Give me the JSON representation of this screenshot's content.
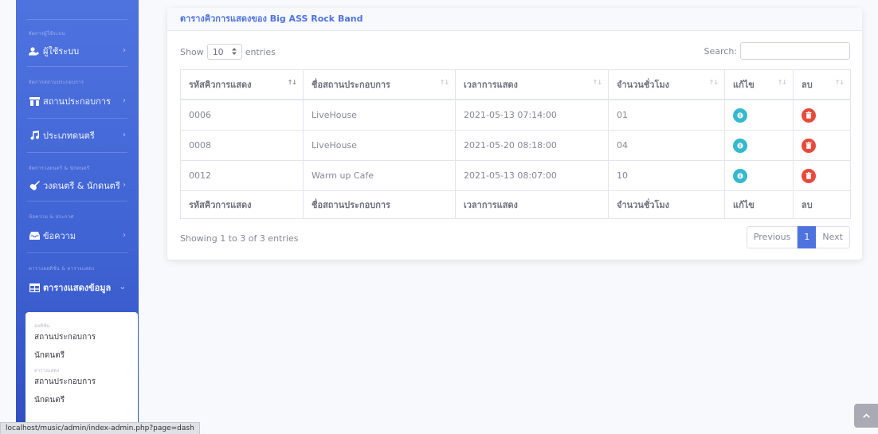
{
  "sidebar": {
    "sections": [
      {
        "heading": "จัดการผู้ใช้ระบบ",
        "items": [
          {
            "label": "ผู้ใช้ระบบ",
            "icon": "users-icon",
            "chevron": "›"
          }
        ]
      },
      {
        "heading": "จัดการสถานประกอบการ",
        "items": [
          {
            "label": "สถานประกอบการ",
            "icon": "store-icon",
            "chevron": "›"
          },
          {
            "label": "ประเภทดนตรี",
            "icon": "music-icon",
            "chevron": "›"
          }
        ]
      },
      {
        "heading": "จัดการวงดนตรี & นักดนตรี",
        "items": [
          {
            "label": "วงดนตรี & นักดนตรี",
            "icon": "guitar-icon",
            "chevron": "›"
          }
        ]
      },
      {
        "heading": "ข้อความ & ประกาศ",
        "items": [
          {
            "label": "ข้อความ",
            "icon": "inbox-icon",
            "chevron": "›"
          }
        ]
      },
      {
        "heading": "ตารางออดิชั่น & ตารางแสดง",
        "items": [
          {
            "label": "ตารางแสดงข้อมูล",
            "icon": "table-icon",
            "chevron": "⌄"
          }
        ]
      }
    ],
    "submenu": {
      "heading1": "ออดิชั่น",
      "items1": [
        "สถานประกอบการ",
        "นักดนตรี"
      ],
      "heading2": "ตารางแสดง",
      "items2": [
        "สถานประกอบการ",
        "นักดนตรี"
      ]
    }
  },
  "statusbar": {
    "url": "localhost/music/admin/index-admin.php?page=dash"
  },
  "card": {
    "title": "ตารางคิวการแสดงของ Big ASS Rock Band",
    "show_label": "Show",
    "entries_value": "10",
    "entries_label": "entries",
    "search_label": "Search:",
    "search_value": "",
    "columns": [
      "รหัสคิวการแสดง",
      "ชื่อสถานประกอบการ",
      "เวลาการแสดง",
      "จำนวนชั่วโมง",
      "แก้ไข",
      "ลบ"
    ],
    "rows": [
      {
        "id": "0006",
        "venue": "LiveHouse",
        "time": "2021-05-13 07:14:00",
        "hours": "01"
      },
      {
        "id": "0008",
        "venue": "LiveHouse",
        "time": "2021-05-20 08:18:00",
        "hours": "04"
      },
      {
        "id": "0012",
        "venue": "Warm up Cafe",
        "time": "2021-05-13 08:07:00",
        "hours": "10"
      }
    ],
    "info": "Showing 1 to 3 of 3 entries",
    "pager": {
      "previous": "Previous",
      "current": "1",
      "next": "Next"
    }
  },
  "colors": {
    "primary": "#4e73df",
    "info": "#36b9cc",
    "danger": "#e74a3b"
  }
}
